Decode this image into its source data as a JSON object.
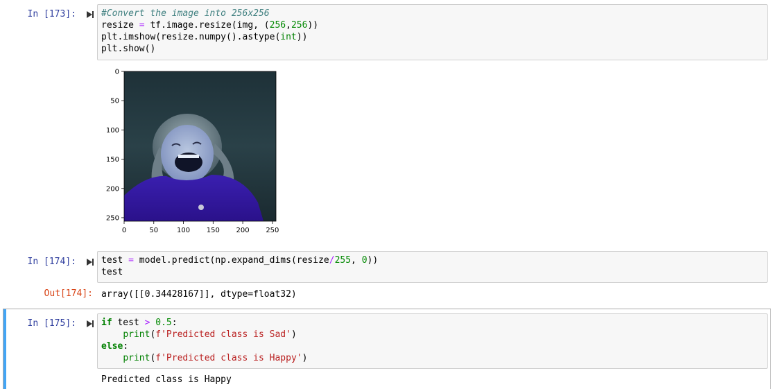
{
  "cells": [
    {
      "prompt": "In [173]:",
      "lines": [
        [
          {
            "t": "#Convert the image into 256x256",
            "c": "cm-comment"
          }
        ],
        [
          {
            "t": "resize "
          },
          {
            "t": "=",
            "c": "cm-op"
          },
          {
            "t": " tf.image.resize(img, ("
          },
          {
            "t": "256",
            "c": "cm-num"
          },
          {
            "t": ","
          },
          {
            "t": "256",
            "c": "cm-num"
          },
          {
            "t": "))"
          }
        ],
        [
          {
            "t": "plt.imshow(resize.numpy().astype("
          },
          {
            "t": "int",
            "c": "cm-builtin"
          },
          {
            "t": "))"
          }
        ],
        [
          {
            "t": "plt.show()"
          }
        ]
      ]
    },
    {
      "prompt": "In [174]:",
      "lines": [
        [
          {
            "t": "test "
          },
          {
            "t": "=",
            "c": "cm-op"
          },
          {
            "t": " model.predict(np.expand_dims(resize"
          },
          {
            "t": "/",
            "c": "cm-op"
          },
          {
            "t": "255",
            "c": "cm-num"
          },
          {
            "t": ", "
          },
          {
            "t": "0",
            "c": "cm-num"
          },
          {
            "t": "))"
          }
        ],
        [
          {
            "t": "test"
          }
        ]
      ],
      "out_prompt": "Out[174]:",
      "output": "array([[0.34428167]], dtype=float32)"
    },
    {
      "prompt": "In [175]:",
      "lines": [
        [
          {
            "t": "if",
            "c": "cm-kw"
          },
          {
            "t": " test "
          },
          {
            "t": ">",
            "c": "cm-op"
          },
          {
            "t": " "
          },
          {
            "t": "0.5",
            "c": "cm-num"
          },
          {
            "t": ":"
          }
        ],
        [
          {
            "t": "    "
          },
          {
            "t": "print",
            "c": "cm-builtin"
          },
          {
            "t": "("
          },
          {
            "t": "f'Predicted class is Sad'",
            "c": "cm-str"
          },
          {
            "t": ")"
          }
        ],
        [
          {
            "t": "else",
            "c": "cm-kw"
          },
          {
            "t": ":"
          }
        ],
        [
          {
            "t": "    "
          },
          {
            "t": "print",
            "c": "cm-builtin"
          },
          {
            "t": "("
          },
          {
            "t": "f'Predicted class is Happy'",
            "c": "cm-str"
          },
          {
            "t": ")"
          }
        ]
      ],
      "output": "Predicted class is Happy"
    }
  ],
  "plot": {
    "x_ticks": [
      "0",
      "50",
      "100",
      "150",
      "200",
      "250"
    ],
    "y_ticks": [
      "0",
      "50",
      "100",
      "150",
      "200",
      "250"
    ],
    "x_tick_values": [
      0,
      50,
      100,
      150,
      200,
      250
    ],
    "y_tick_values": [
      0,
      50,
      100,
      150,
      200,
      250
    ],
    "image_extent": [
      256,
      256
    ]
  },
  "colors": {
    "prompt_in": "#303f9f",
    "prompt_out": "#d84315",
    "selected_bar": "#42a5f5"
  },
  "icons": [
    "run-cell-icon"
  ]
}
